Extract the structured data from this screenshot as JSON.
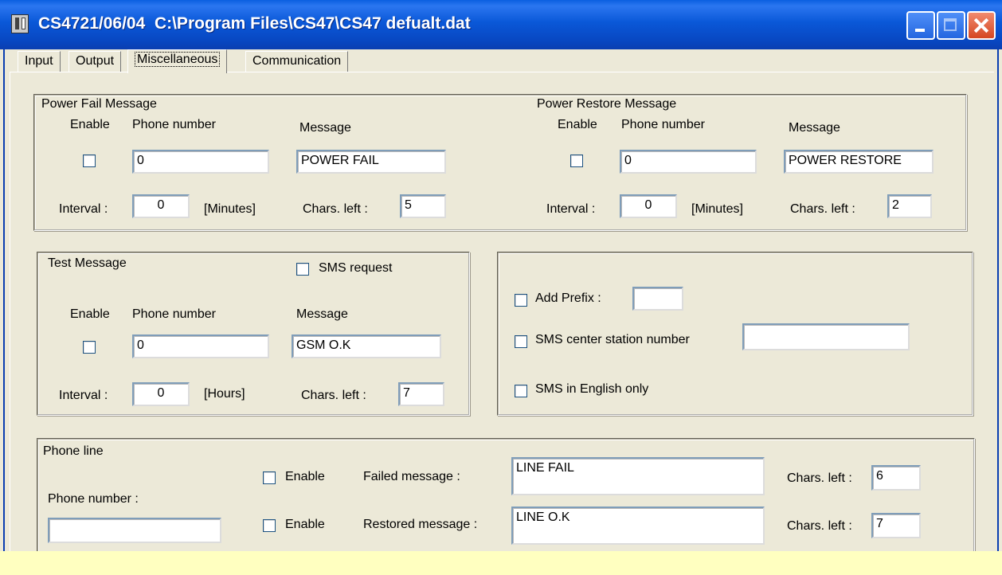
{
  "window": {
    "title": "CS4721/06/04  C:\\Program Files\\CS47\\CS47 defualt.dat"
  },
  "tabs": [
    {
      "label": "Input",
      "active": false
    },
    {
      "label": "Output",
      "active": false
    },
    {
      "label": "Miscellaneous",
      "active": true
    },
    {
      "label": "Communication",
      "active": false
    }
  ],
  "power_fail": {
    "title": "Power Fail Message",
    "enable_label": "Enable",
    "phone_label": "Phone number",
    "message_label": "Message",
    "enabled": false,
    "phone": "0",
    "message": "POWER FAIL",
    "interval_label": "Interval :",
    "interval": "0",
    "interval_unit": "[Minutes]",
    "chars_left_label": "Chars. left :",
    "chars_left": "5"
  },
  "power_restore": {
    "title": "Power  Restore Message",
    "enable_label": "Enable",
    "phone_label": "Phone number",
    "message_label": "Message",
    "enabled": false,
    "phone": "0",
    "message": "POWER RESTORE",
    "interval_label": "Interval :",
    "interval": "0",
    "interval_unit": "[Minutes]",
    "chars_left_label": "Chars. left :",
    "chars_left": "2"
  },
  "test_message": {
    "title": "Test Message",
    "sms_request_label": "SMS request",
    "sms_request": false,
    "enable_label": "Enable",
    "phone_label": "Phone number",
    "message_label": "Message",
    "enabled": false,
    "phone": "0",
    "message": "GSM  O.K",
    "interval_label": "Interval :",
    "interval": "0",
    "interval_unit": "[Hours]",
    "chars_left_label": "Chars. left :",
    "chars_left": "7"
  },
  "sms_options": {
    "add_prefix_label": "Add Prefix :",
    "add_prefix": false,
    "prefix": "",
    "sms_center_label": "SMS center station number",
    "sms_center": false,
    "sms_center_number": "",
    "english_only_label": "SMS in English only",
    "english_only": false
  },
  "phone_line": {
    "title": "Phone line",
    "phone_number_label": "Phone number :",
    "phone_number": "",
    "failed_enable_label": "Enable",
    "failed_enabled": false,
    "failed_label": "Failed message :",
    "failed_message": "LINE FAIL",
    "failed_chars_label": "Chars. left :",
    "failed_chars_left": "6",
    "restored_enable_label": "Enable",
    "restored_enabled": false,
    "restored_label": "Restored message :",
    "restored_message": "LINE O.K",
    "restored_chars_label": "Chars. left :",
    "restored_chars_left": "7"
  },
  "colors": {
    "titlebar": "#0a58d8",
    "face": "#ece9d8",
    "overlay": "#ffffc0",
    "close_button": "#d54722"
  }
}
